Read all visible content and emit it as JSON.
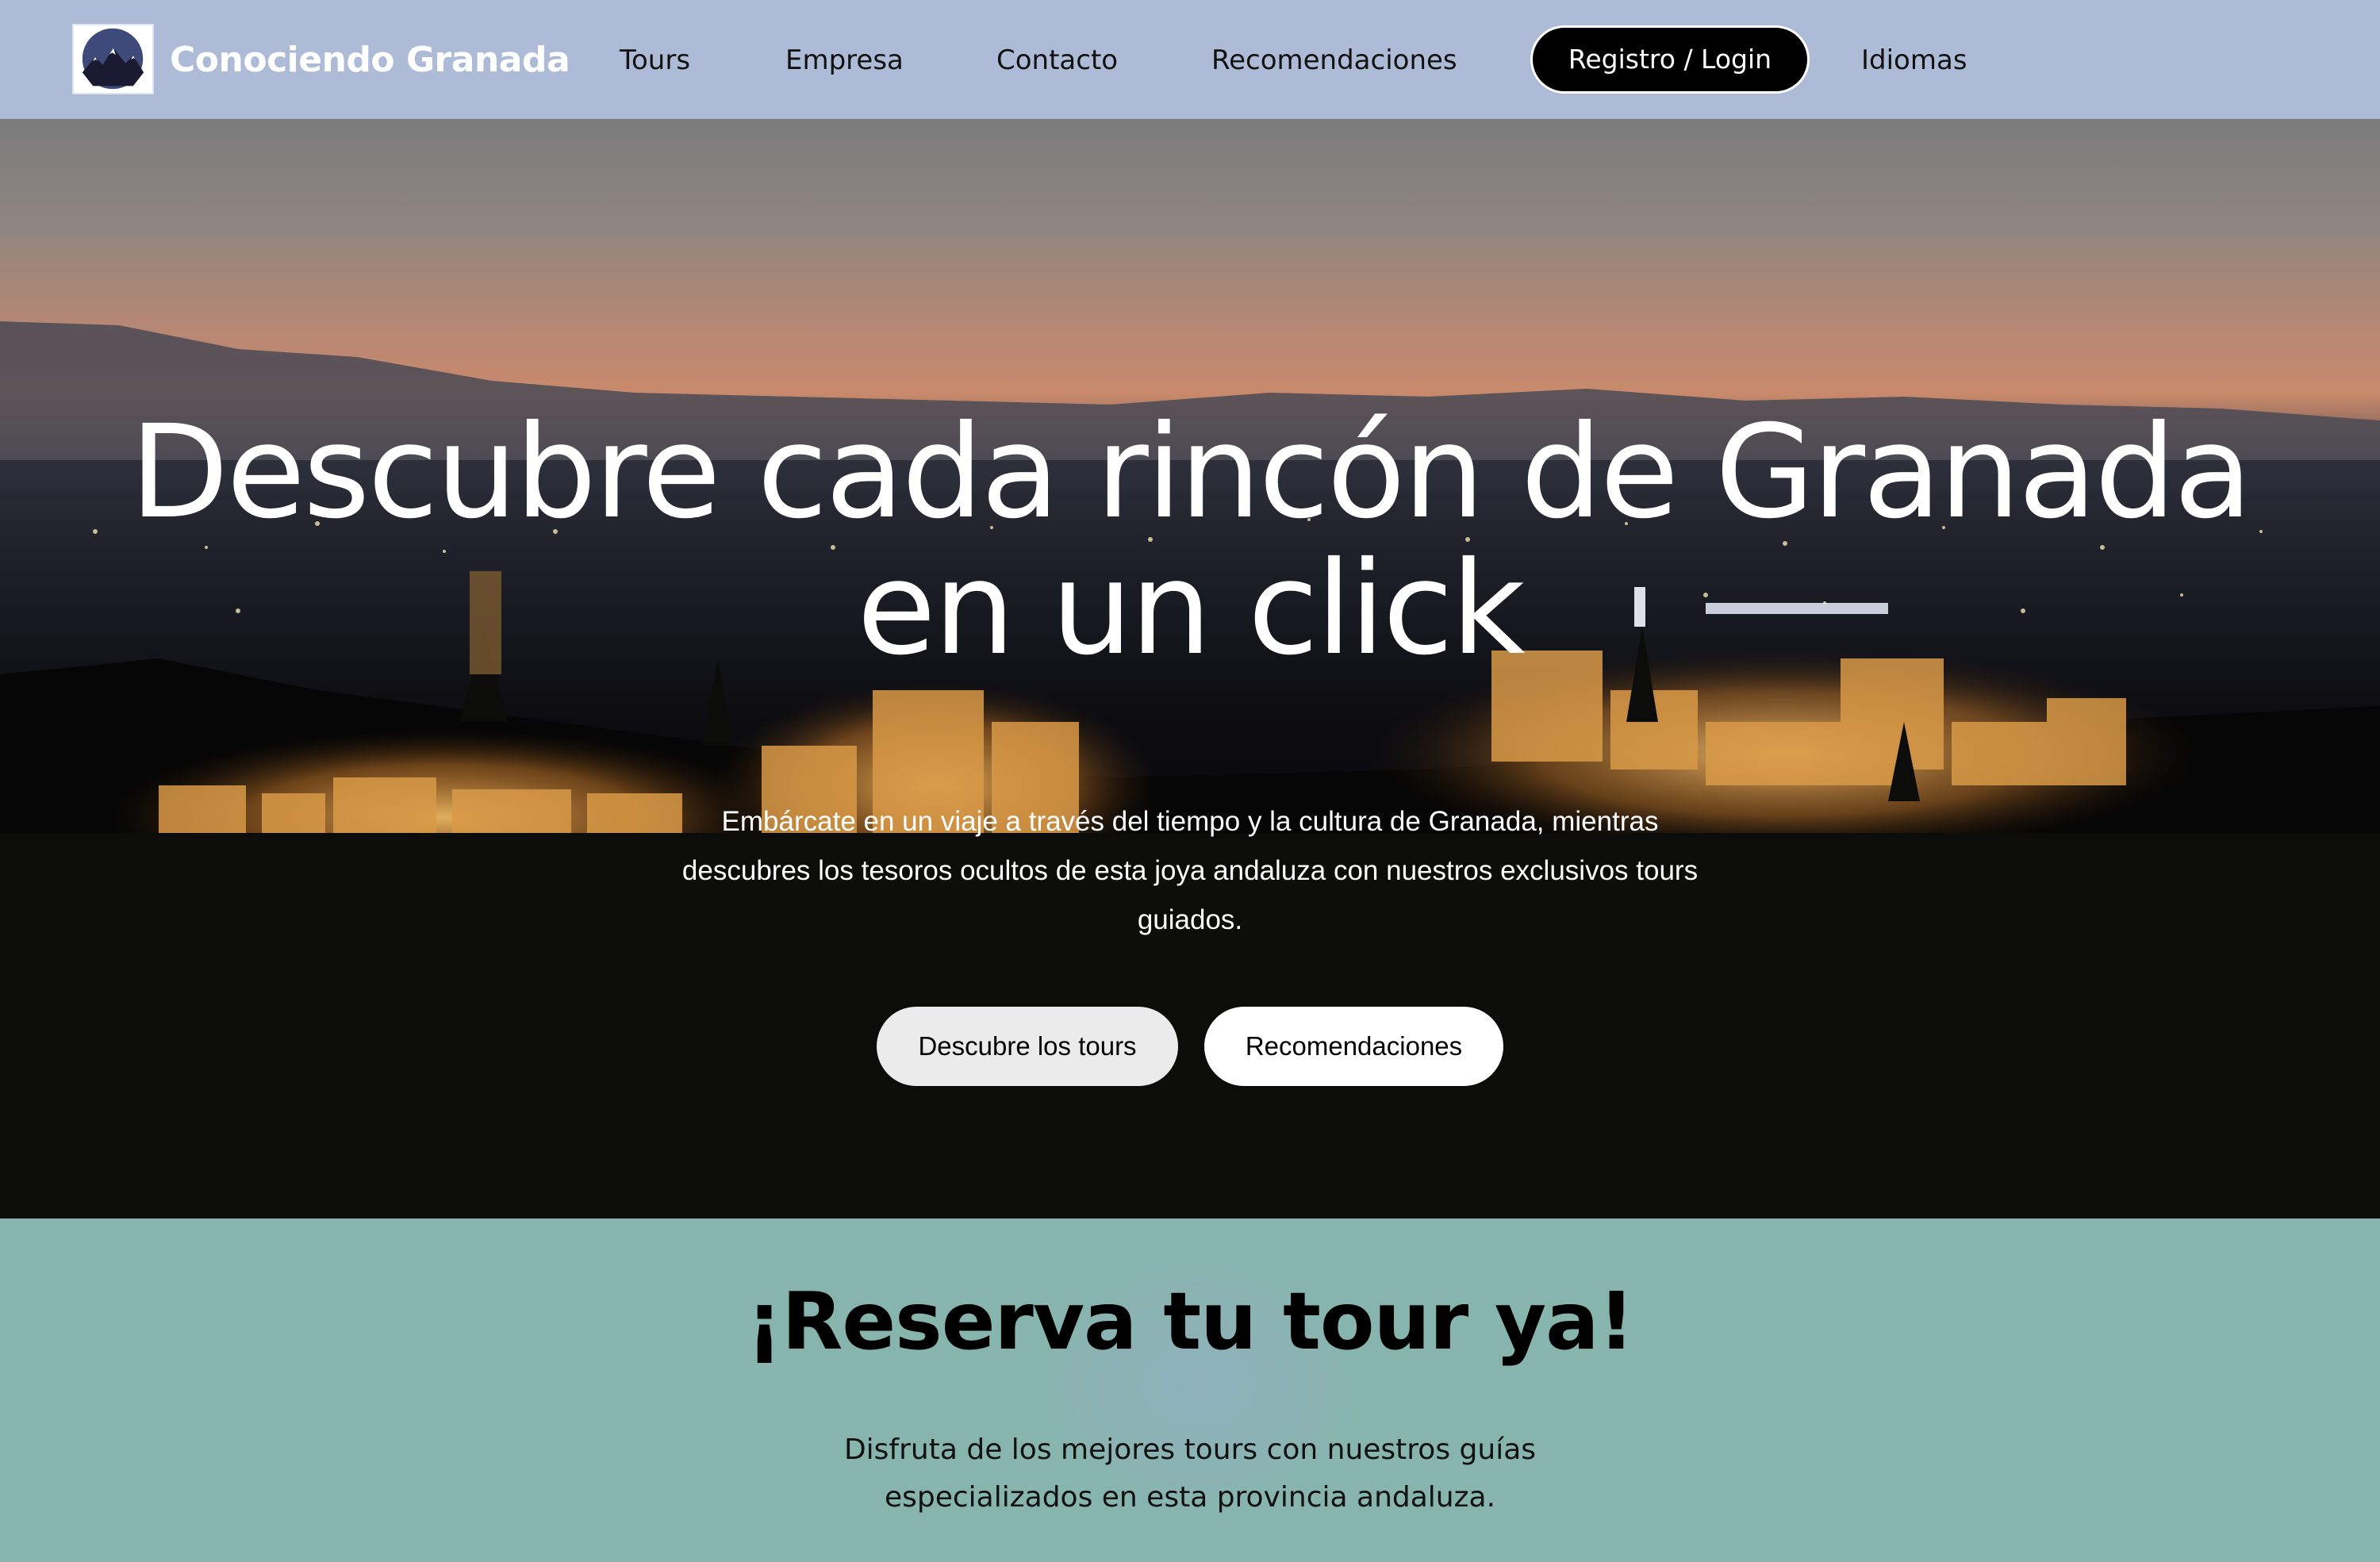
{
  "navbar": {
    "brand": "Conociendo Granada",
    "logo_icon": "mountain-moon-icon",
    "links": {
      "tours": "Tours",
      "empresa": "Empresa",
      "contacto": "Contacto",
      "recomendaciones": "Recomendaciones",
      "idiomas": "Idiomas"
    },
    "login_label": "Registro / Login"
  },
  "hero": {
    "title": "Descubre cada rincón de Granada en un click",
    "subtitle": "Embárcate en un viaje a través del tiempo y la cultura de Granada, mientras descubres los tesoros ocultos de esta joya andaluza con nuestros exclusivos tours guiados.",
    "buttons": {
      "tours": "Descubre los tours",
      "recomendaciones": "Recomendaciones"
    }
  },
  "reserva": {
    "title": "¡Reserva tu tour ya!",
    "text": "Disfruta de los mejores tours con nuestros guías especializados en esta provincia andaluza."
  },
  "colors": {
    "navbar_bg": "#aebbd6",
    "reserva_bg": "#87b4ad",
    "login_bg": "#000000"
  }
}
